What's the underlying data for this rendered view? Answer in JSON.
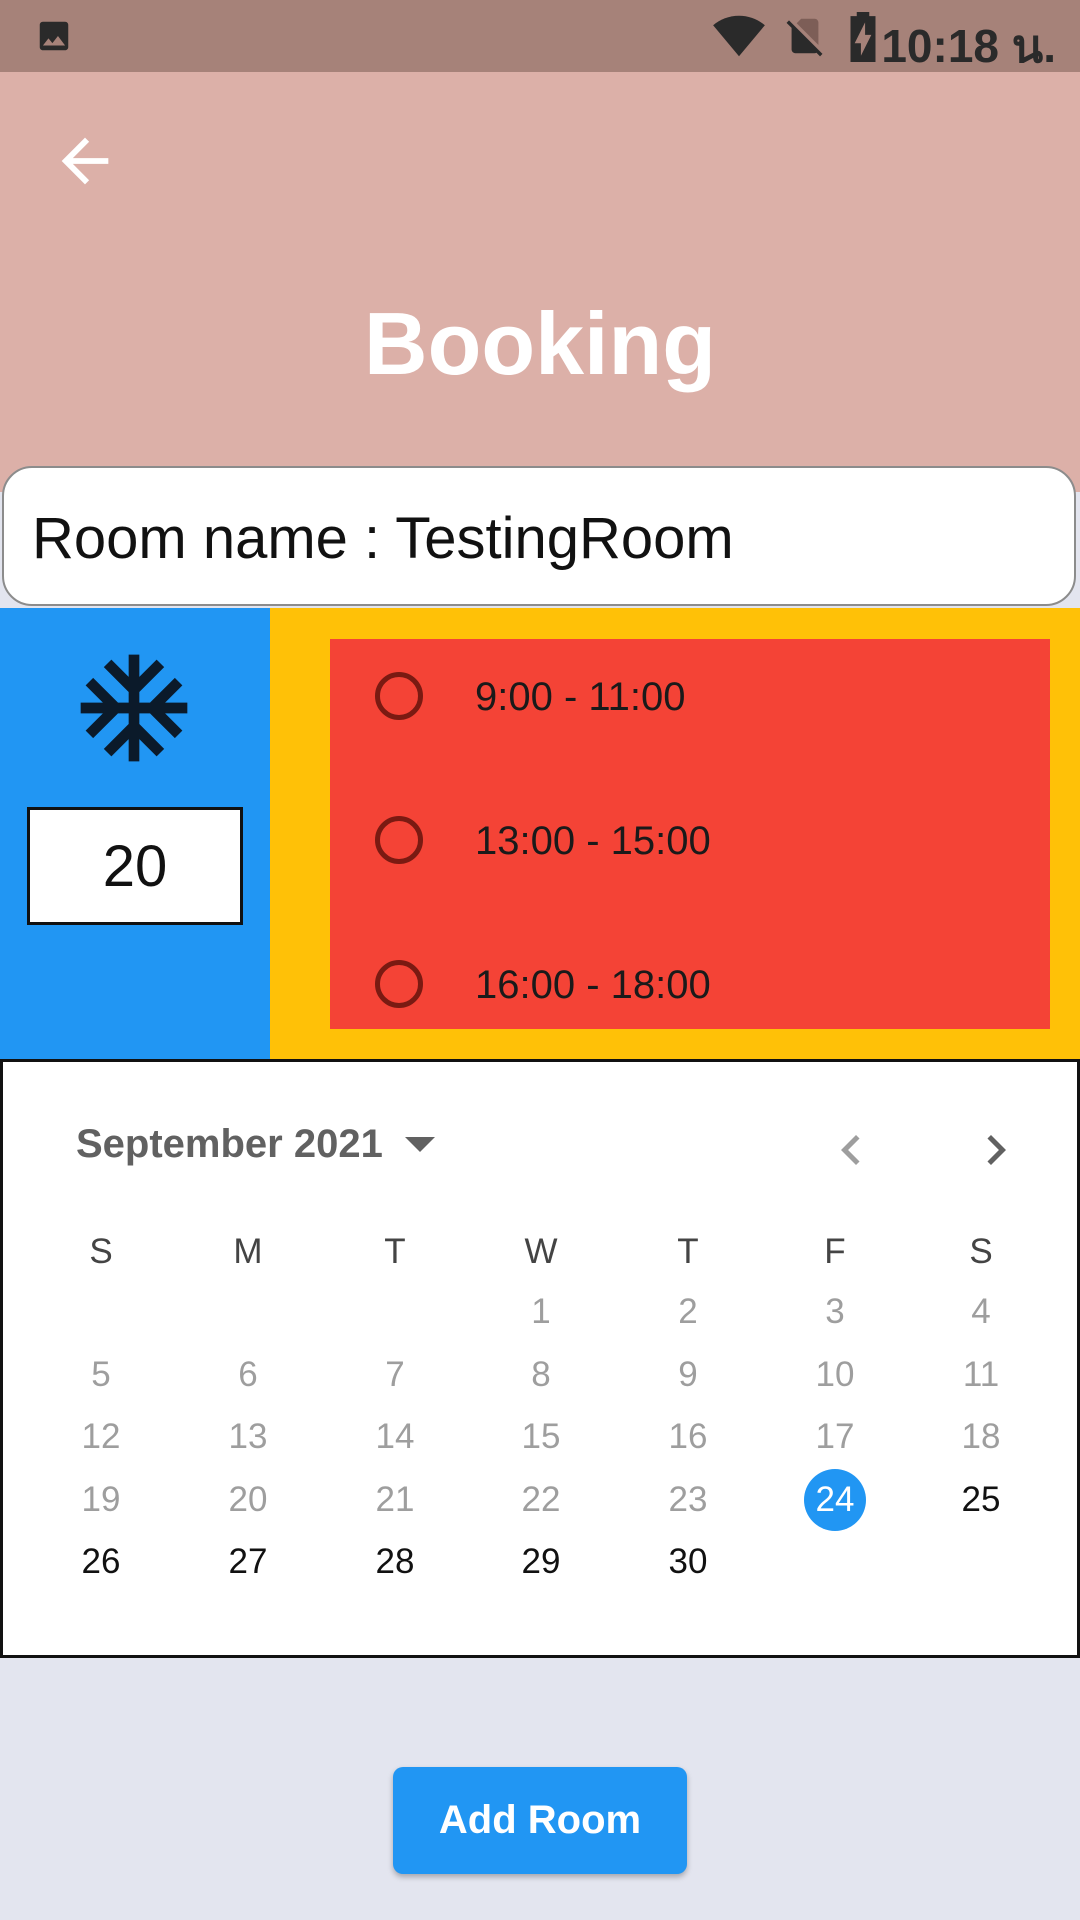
{
  "status_bar": {
    "time": "10:18 น."
  },
  "header": {
    "title": "Booking"
  },
  "room": {
    "label": "Room name : TestingRoom"
  },
  "ac": {
    "temperature": "20"
  },
  "time_slots": [
    "9:00 - 11:00",
    "13:00 - 15:00",
    "16:00 - 18:00"
  ],
  "calendar": {
    "month_label": "September 2021",
    "weekdays": [
      "S",
      "M",
      "T",
      "W",
      "T",
      "F",
      "S"
    ],
    "first_weekday_index": 3,
    "days_in_month": 30,
    "selected_day": 24,
    "first_selectable_day": 24
  },
  "actions": {
    "add_room_label": "Add Room"
  },
  "colors": {
    "status_bar": "#a68279",
    "header": "#dcb0a8",
    "accent_blue": "#2196f3",
    "amber": "#ffc107",
    "red": "#f44336",
    "background": "#e3e5ef"
  }
}
